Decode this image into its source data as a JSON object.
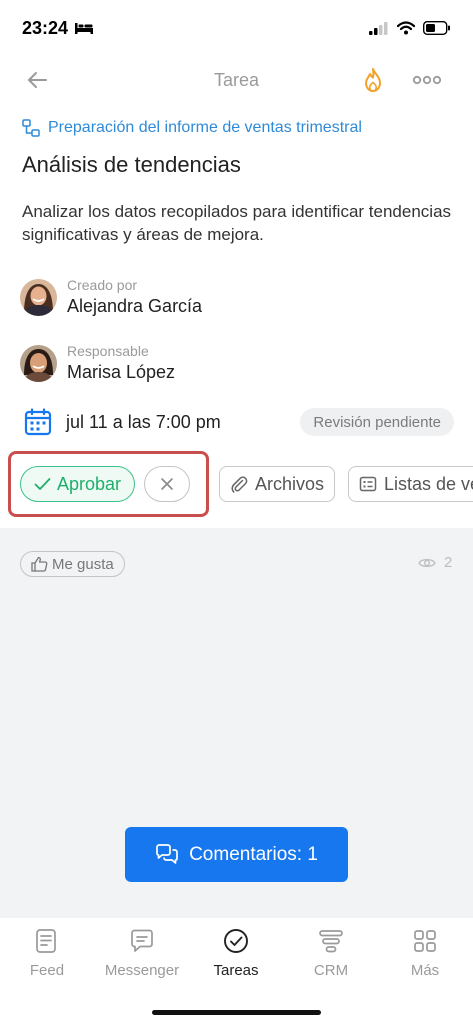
{
  "status_bar": {
    "time": "23:24"
  },
  "header": {
    "title": "Tarea"
  },
  "task": {
    "parent_link": "Preparación del informe de ventas trimestral",
    "title": "Análisis de tendencias",
    "description": "Analizar los datos recopilados para identificar tendencias significativas y áreas de mejora."
  },
  "people": {
    "creator": {
      "role": "Creado por",
      "name": "Alejandra García"
    },
    "assignee": {
      "role": "Responsable",
      "name": "Marisa López"
    }
  },
  "deadline": {
    "text": "jul 11 a las 7:00 pm",
    "status": "Revisión pendiente"
  },
  "actions": {
    "approve": "Aprobar",
    "files": "Archivos",
    "checklists": "Listas de ve"
  },
  "social": {
    "like": "Me gusta",
    "views": "2"
  },
  "comments": {
    "label": "Comentarios: 1"
  },
  "tabs": [
    {
      "label": "Feed"
    },
    {
      "label": "Messenger"
    },
    {
      "label": "Tareas"
    },
    {
      "label": "CRM"
    },
    {
      "label": "Más"
    }
  ],
  "colors": {
    "accent": "#1677ee",
    "link": "#2f8ad8",
    "approve_green": "#1faf6b",
    "highlight_red": "#c94f4f",
    "flame_orange": "#f2a22b"
  }
}
